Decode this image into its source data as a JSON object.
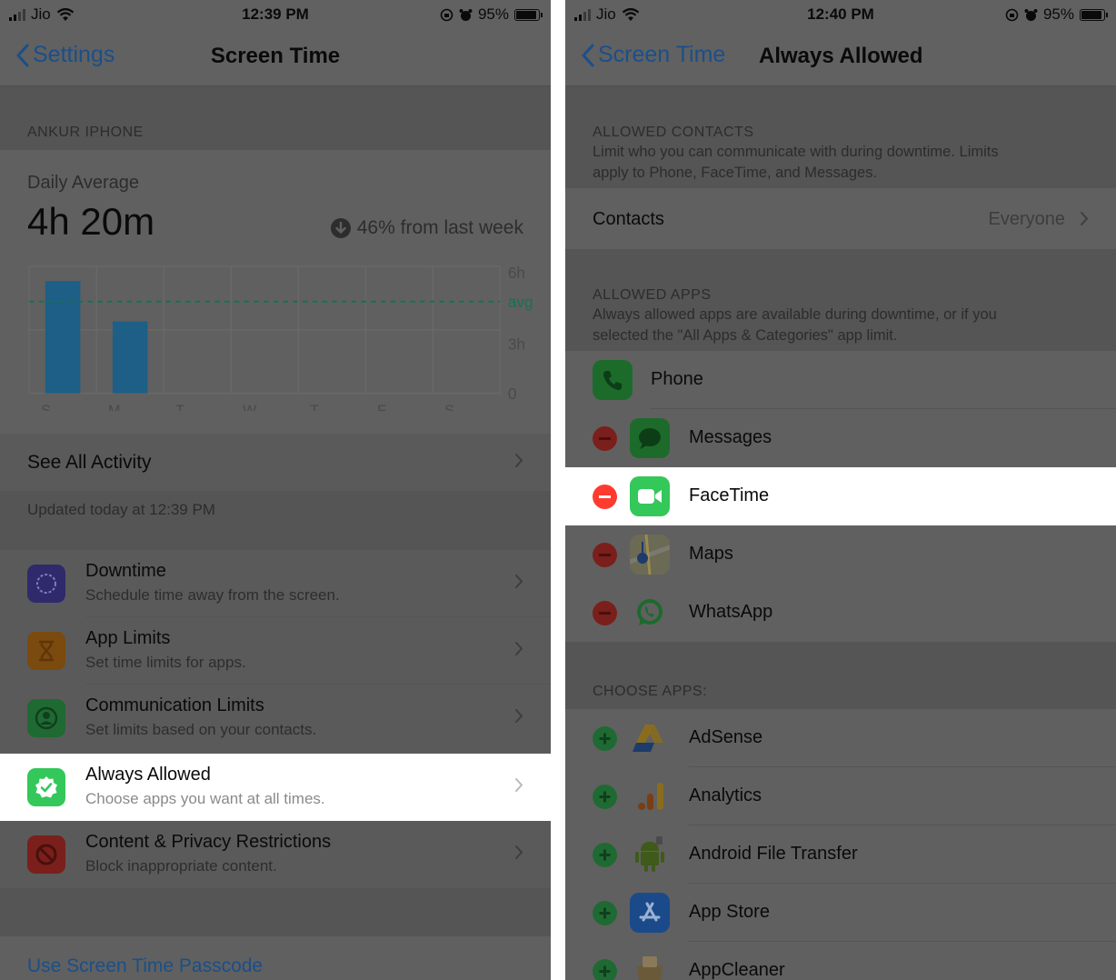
{
  "left": {
    "status": {
      "carrier": "Jio",
      "time": "12:39 PM",
      "battery": "95%"
    },
    "nav": {
      "back": "Settings",
      "title": "Screen Time"
    },
    "device_header": "ANKUR IPHONE",
    "daily_average_label": "Daily Average",
    "daily_average_value": "4h 20m",
    "trend": "46% from last week",
    "chart_data": {
      "type": "bar",
      "categories": [
        "S",
        "M",
        "T",
        "W",
        "T",
        "F",
        "S"
      ],
      "values": [
        5.3,
        3.4,
        0,
        0,
        0,
        0,
        0
      ],
      "ylim": [
        0,
        6
      ],
      "y_ticks": [
        "6h",
        "3h",
        "0"
      ],
      "avg_label": "avg",
      "avg_value": 4.33,
      "bar_color": "#1d5f86",
      "avg_color": "#1b6f55"
    },
    "see_all": "See All Activity",
    "updated": "Updated today at 12:39 PM",
    "items": [
      {
        "title": "Downtime",
        "sub": "Schedule time away from the screen.",
        "icon": "moon-clock-icon",
        "color": "#2f2a6b"
      },
      {
        "title": "App Limits",
        "sub": "Set time limits for apps.",
        "icon": "hourglass-icon",
        "color": "#7a4a0e"
      },
      {
        "title": "Communication Limits",
        "sub": "Set limits based on your contacts.",
        "icon": "person-circle-icon",
        "color": "#1f6a33"
      },
      {
        "title": "Always Allowed",
        "sub": "Choose apps you want at all times.",
        "icon": "checkmark-seal-icon",
        "color": "#34c759"
      },
      {
        "title": "Content & Privacy Restrictions",
        "sub": "Block inappropriate content.",
        "icon": "no-entry-icon",
        "color": "#7a1f1b"
      }
    ],
    "passcode": "Use Screen Time Passcode"
  },
  "right": {
    "status": {
      "carrier": "Jio",
      "time": "12:40 PM",
      "battery": "95%"
    },
    "nav": {
      "back": "Screen Time",
      "title": "Always Allowed"
    },
    "contacts_header": "ALLOWED CONTACTS",
    "contacts_desc_1": "Limit who you can communicate with during downtime. Limits",
    "contacts_desc_2": "apply to Phone, FaceTime, and Messages.",
    "contacts_label": "Contacts",
    "contacts_value": "Everyone",
    "apps_header": "ALLOWED APPS",
    "apps_desc_1": "Always allowed apps are available during downtime, or if you",
    "apps_desc_2": "selected the \"All Apps & Categories\" app limit.",
    "allowed_apps": [
      "Phone",
      "Messages",
      "FaceTime",
      "Maps",
      "WhatsApp"
    ],
    "choose_header": "CHOOSE APPS:",
    "choose_apps": [
      "AdSense",
      "Analytics",
      "Android File Transfer",
      "App Store",
      "AppCleaner"
    ]
  }
}
